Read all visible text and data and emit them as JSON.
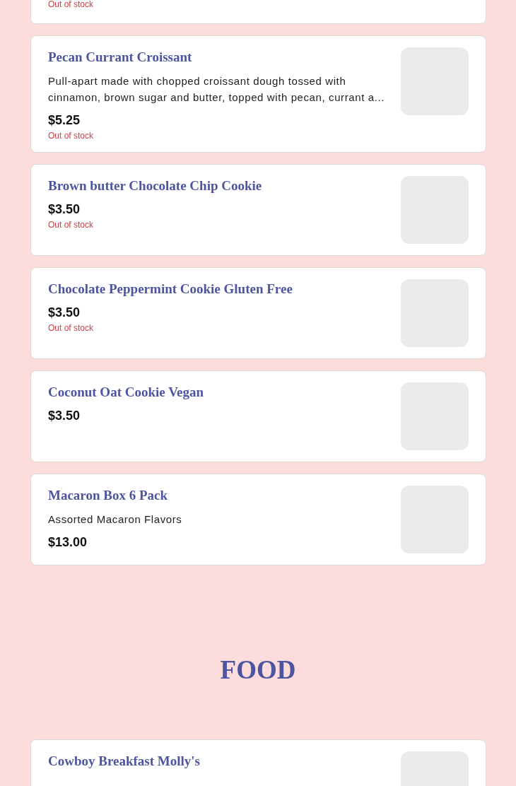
{
  "sections": [
    {
      "items": [
        {
          "stock": "Out of stock"
        },
        {
          "name": "Pecan Currant Croissant",
          "description": "Pull-apart made with chopped croissant dough tossed with cinnamon, brown sugar and butter, topped with pecan, currant a...",
          "price": "$5.25",
          "stock": "Out of stock"
        },
        {
          "name": "Brown butter Chocolate Chip Cookie",
          "price": "$3.50",
          "stock": "Out of stock"
        },
        {
          "name": "Chocolate Peppermint Cookie Gluten Free",
          "price": "$3.50",
          "stock": "Out of stock"
        },
        {
          "name": "Coconut Oat Cookie Vegan",
          "price": "$3.50"
        },
        {
          "name": "Macaron Box 6 Pack",
          "description": "Assorted Macaron Flavors",
          "price": "$13.00"
        }
      ]
    },
    {
      "title": "FOOD",
      "items": [
        {
          "name": "Cowboy Breakfast Molly's"
        }
      ]
    }
  ]
}
